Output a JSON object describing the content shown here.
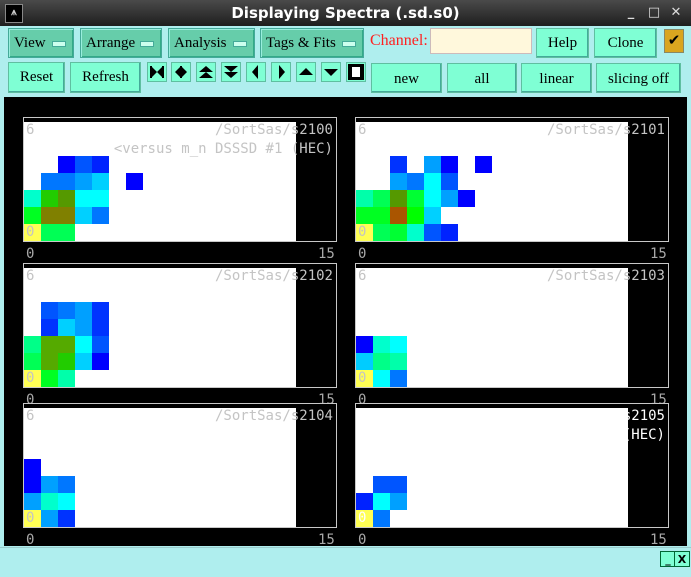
{
  "window": {
    "title": "Displaying Spectra (.sd.s0)"
  },
  "menus": [
    {
      "label": "View"
    },
    {
      "label": "Arrange"
    },
    {
      "label": "Analysis"
    },
    {
      "label": "Tags & Fits"
    }
  ],
  "channel": {
    "label": "Channel:",
    "value": ""
  },
  "buttons": {
    "help": "Help",
    "clone": "Clone",
    "reset": "Reset",
    "refresh": "Refresh",
    "new": "new",
    "all": "all",
    "linear": "linear",
    "slicing": "slicing off"
  },
  "checkbox_checked": true,
  "nav_icons": [
    "expand-horizontal",
    "compress-horizontal",
    "expand-vertical",
    "compress-vertical",
    "left",
    "right",
    "up",
    "down",
    "full"
  ],
  "colors": {
    "bg": "#afeeee",
    "button": "#7fffd4",
    "menu": "#66cdaa",
    "channel_label": "#ff2020"
  },
  "panels": [
    {
      "name": "/SortSas/s2100",
      "subtitle": "<versus m_n DSSSD #1 (HEC)",
      "ymax": "6",
      "ymin": "0",
      "xmin": "0",
      "xmax": "15",
      "cells": [
        [
          2,
          4,
          "#0000ff"
        ],
        [
          3,
          4,
          "#0055ff"
        ],
        [
          4,
          4,
          "#0022ff"
        ],
        [
          1,
          3,
          "#0077ff"
        ],
        [
          2,
          3,
          "#0077ff"
        ],
        [
          3,
          3,
          "#00a0ff"
        ],
        [
          4,
          3,
          "#00d0ff"
        ],
        [
          6,
          3,
          "#0000ff"
        ],
        [
          0,
          2,
          "#00ffcc"
        ],
        [
          1,
          2,
          "#22cc00"
        ],
        [
          2,
          2,
          "#559900"
        ],
        [
          3,
          2,
          "#00ffff"
        ],
        [
          4,
          2,
          "#00ffff"
        ],
        [
          0,
          1,
          "#00ff22"
        ],
        [
          1,
          1,
          "#808000"
        ],
        [
          2,
          1,
          "#808000"
        ],
        [
          3,
          1,
          "#00d0ff"
        ],
        [
          4,
          1,
          "#0077ff"
        ],
        [
          0,
          0,
          "#ffff55"
        ],
        [
          1,
          0,
          "#00ff55"
        ],
        [
          2,
          0,
          "#00ff55"
        ]
      ]
    },
    {
      "name": "/SortSas/s2101",
      "subtitle": "",
      "ymax": "6",
      "ymin": "0",
      "xmin": "0",
      "xmax": "15",
      "cells": [
        [
          2,
          4,
          "#0033ff"
        ],
        [
          4,
          4,
          "#00a0ff"
        ],
        [
          5,
          4,
          "#0000ff"
        ],
        [
          7,
          4,
          "#0000ff"
        ],
        [
          2,
          3,
          "#00a0ff"
        ],
        [
          3,
          3,
          "#0077ff"
        ],
        [
          4,
          3,
          "#00ffff"
        ],
        [
          5,
          3,
          "#0055ff"
        ],
        [
          0,
          2,
          "#00ffaa"
        ],
        [
          1,
          2,
          "#00ff55"
        ],
        [
          2,
          2,
          "#559900"
        ],
        [
          3,
          2,
          "#00ff33"
        ],
        [
          4,
          2,
          "#00ffff"
        ],
        [
          5,
          2,
          "#00a0ff"
        ],
        [
          6,
          2,
          "#0000ff"
        ],
        [
          0,
          1,
          "#00ff22"
        ],
        [
          1,
          1,
          "#00ff22"
        ],
        [
          2,
          1,
          "#aa5500"
        ],
        [
          3,
          1,
          "#00ff00"
        ],
        [
          4,
          1,
          "#00d0ff"
        ],
        [
          0,
          0,
          "#ffff55"
        ],
        [
          1,
          0,
          "#00ff55"
        ],
        [
          2,
          0,
          "#00ff33"
        ],
        [
          3,
          0,
          "#00ffcc"
        ],
        [
          4,
          0,
          "#0055ff"
        ],
        [
          5,
          0,
          "#0022ff"
        ]
      ]
    },
    {
      "name": "/SortSas/s2102",
      "subtitle": "",
      "ymax": "6",
      "ymin": "0",
      "xmin": "0",
      "xmax": "15",
      "cells": [
        [
          1,
          4,
          "#0055ff"
        ],
        [
          2,
          4,
          "#0077ff"
        ],
        [
          3,
          4,
          "#00a0ff"
        ],
        [
          4,
          4,
          "#0033ff"
        ],
        [
          1,
          3,
          "#0033ff"
        ],
        [
          2,
          3,
          "#00d0ff"
        ],
        [
          3,
          3,
          "#00a0ff"
        ],
        [
          4,
          3,
          "#0033ff"
        ],
        [
          0,
          2,
          "#00ff88"
        ],
        [
          1,
          2,
          "#55aa00"
        ],
        [
          2,
          2,
          "#55aa00"
        ],
        [
          3,
          2,
          "#00ffff"
        ],
        [
          4,
          2,
          "#0055ff"
        ],
        [
          0,
          1,
          "#00ff55"
        ],
        [
          1,
          1,
          "#55aa00"
        ],
        [
          2,
          1,
          "#22cc00"
        ],
        [
          3,
          1,
          "#00d0ff"
        ],
        [
          4,
          1,
          "#0000ff"
        ],
        [
          0,
          0,
          "#ffff55"
        ],
        [
          1,
          0,
          "#00ff22"
        ],
        [
          2,
          0,
          "#00ffaa"
        ]
      ]
    },
    {
      "name": "/SortSas/s2103",
      "subtitle": "",
      "ymax": "6",
      "ymin": "0",
      "xmin": "0",
      "xmax": "15",
      "cells": [
        [
          0,
          2,
          "#0000ff"
        ],
        [
          1,
          2,
          "#00ffcc"
        ],
        [
          2,
          2,
          "#00ffff"
        ],
        [
          0,
          1,
          "#00ccff"
        ],
        [
          1,
          1,
          "#00ff88"
        ],
        [
          2,
          1,
          "#00ffaa"
        ],
        [
          0,
          0,
          "#ffff55"
        ],
        [
          1,
          0,
          "#00ffff"
        ],
        [
          2,
          0,
          "#0077ff"
        ]
      ]
    },
    {
      "name": "/SortSas/s2104",
      "subtitle": "",
      "ymax": "6",
      "ymin": "0",
      "xmin": "0",
      "xmax": "15",
      "cells": [
        [
          0,
          3,
          "#0000ff"
        ],
        [
          0,
          2,
          "#0000ff"
        ],
        [
          1,
          2,
          "#00a0ff"
        ],
        [
          2,
          2,
          "#0077ff"
        ],
        [
          0,
          1,
          "#00a0ff"
        ],
        [
          1,
          1,
          "#00ffcc"
        ],
        [
          2,
          1,
          "#00ffff"
        ],
        [
          0,
          0,
          "#ffff55"
        ],
        [
          1,
          0,
          "#00a0ff"
        ],
        [
          2,
          0,
          "#0033ff"
        ]
      ]
    },
    {
      "name": "/SortSas/s2105",
      "subtitle": "<versus m_n DSSSD #1 (HEC)",
      "ymax": "6",
      "ymin": "0",
      "xmin": "0",
      "xmax": "15",
      "text_color": "#ffffff",
      "cells": [
        [
          1,
          2,
          "#0055ff"
        ],
        [
          2,
          2,
          "#0055ff"
        ],
        [
          0,
          1,
          "#0022ff"
        ],
        [
          1,
          1,
          "#00ffff"
        ],
        [
          2,
          1,
          "#00a0ff"
        ],
        [
          0,
          0,
          "#ffff55"
        ],
        [
          1,
          0,
          "#0077ff"
        ]
      ]
    }
  ],
  "status": {
    "minimize": "_",
    "close": "X"
  }
}
